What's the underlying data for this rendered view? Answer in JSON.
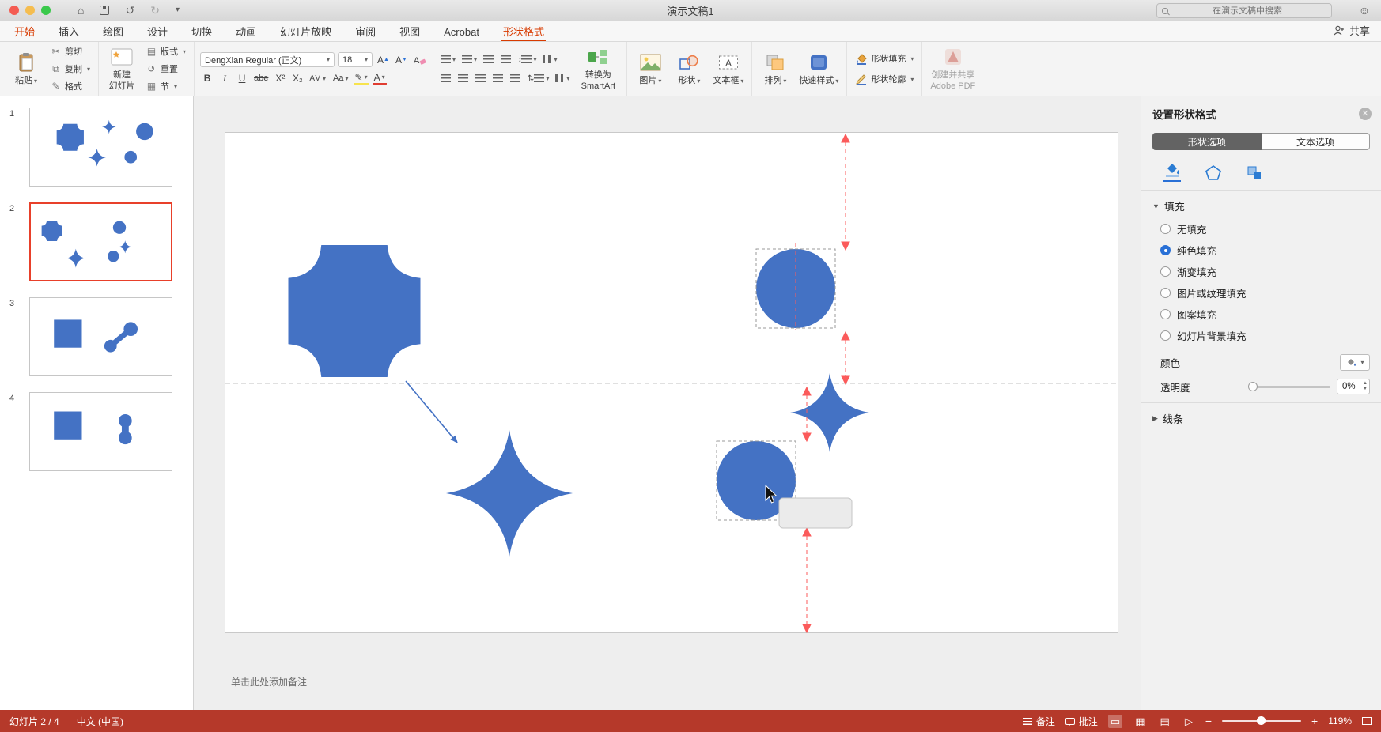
{
  "colors": {
    "shape_blue": "#4472c4",
    "guide_red": "#fb5b5b",
    "accent_red": "#d83b01",
    "status_red": "#b5392a",
    "sel_blue": "#2970d6",
    "thumb_sel": "#e8402a"
  },
  "titlebar": {
    "title": "演示文稿1",
    "search_placeholder": "在演示文稿中搜索",
    "share_label": "共享"
  },
  "tabs": {
    "items": [
      "开始",
      "插入",
      "绘图",
      "设计",
      "切换",
      "动画",
      "幻灯片放映",
      "审阅",
      "视图",
      "Acrobat",
      "形状格式"
    ],
    "active": "形状格式"
  },
  "ribbon": {
    "paste": "粘贴",
    "cut": "剪切",
    "copy": "复制",
    "format_painter": "格式",
    "new_slide": "新建\n幻灯片",
    "layout": "版式",
    "reset": "重置",
    "section": "节",
    "font_name": "DengXian Regular (正文)",
    "font_size": "18",
    "bold": "B",
    "italic": "I",
    "underline": "U",
    "strike": "abe",
    "superscript": "X²",
    "subscript": "X₂",
    "spacing": "AV",
    "case_btn": "Aa",
    "font_color": "A",
    "highlight": "A",
    "smartart": "转换为\nSmartArt",
    "picture": "图片",
    "shape": "形状",
    "textbox": "文本框",
    "arrange": "排列",
    "quick_styles": "快速样式",
    "shape_fill": "形状填充",
    "shape_outline": "形状轮廓",
    "adobe_pdf": "创建并共享\nAdobe PDF"
  },
  "slides": {
    "numbers": [
      "1",
      "2",
      "3",
      "4"
    ],
    "selected": "2"
  },
  "notes": {
    "placeholder": "单击此处添加备注"
  },
  "status_bar": {
    "slide_counter": "幻灯片 2 / 4",
    "language": "中文 (中国)",
    "notes_label": "备注",
    "comments_label": "批注",
    "zoom_level": "119%"
  },
  "format_panel": {
    "title": "设置形状格式",
    "tab_shape": "形状选项",
    "tab_text": "文本选项",
    "fill_section": "填充",
    "fill_options": [
      "无填充",
      "纯色填充",
      "渐变填充",
      "图片或纹理填充",
      "图案填充",
      "幻灯片背景填充"
    ],
    "selected_fill": "纯色填充",
    "color_label": "颜色",
    "transparency_label": "透明度",
    "transparency_value": "0%",
    "line_section": "线条"
  }
}
